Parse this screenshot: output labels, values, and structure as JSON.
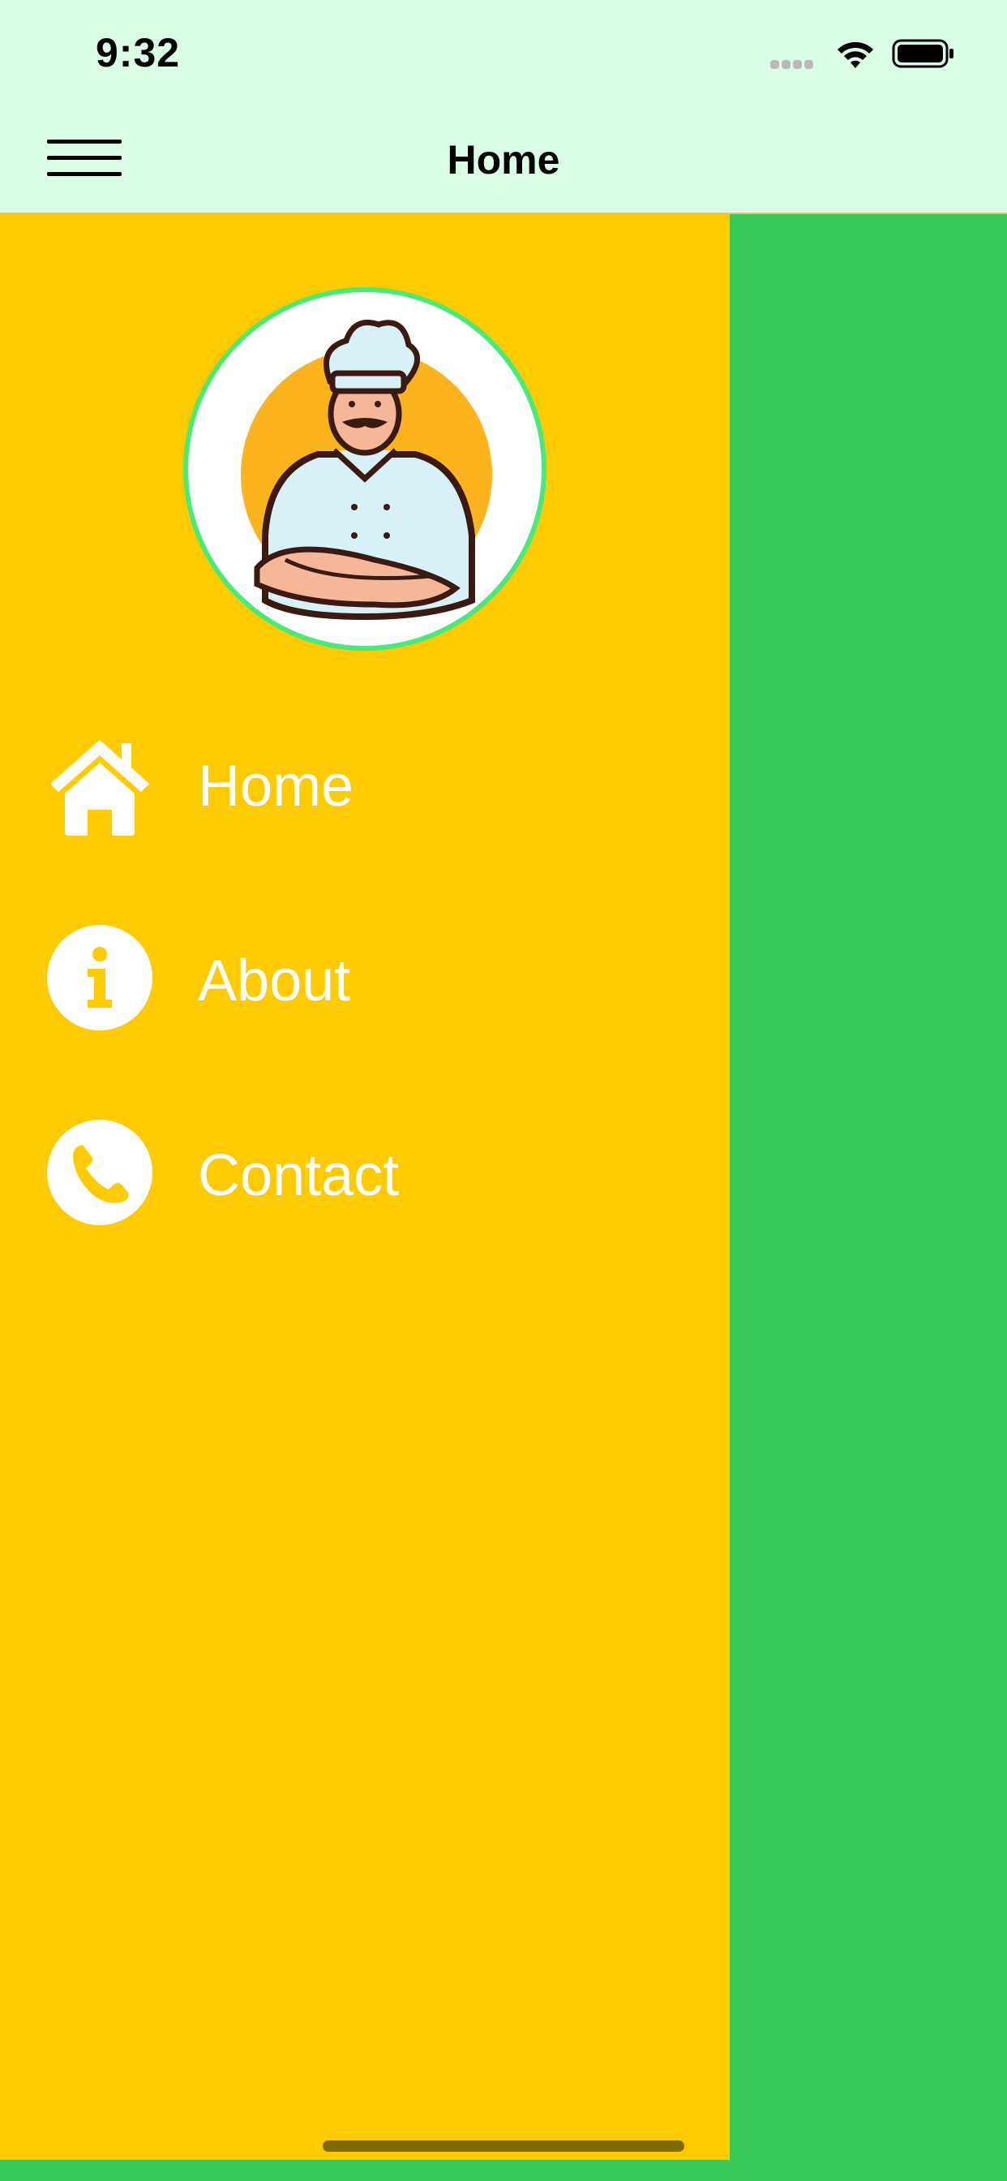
{
  "status_bar": {
    "time": "9:32"
  },
  "header": {
    "title": "Home"
  },
  "drawer": {
    "items": [
      {
        "label": "Home",
        "icon": "home-icon"
      },
      {
        "label": "About",
        "icon": "info-icon"
      },
      {
        "label": "Contact",
        "icon": "phone-icon"
      }
    ]
  },
  "colors": {
    "header_bg": "#dafde5",
    "drawer_bg": "#fecb00",
    "content_bg": "#36c95a",
    "avatar_border": "#48ea7a"
  }
}
